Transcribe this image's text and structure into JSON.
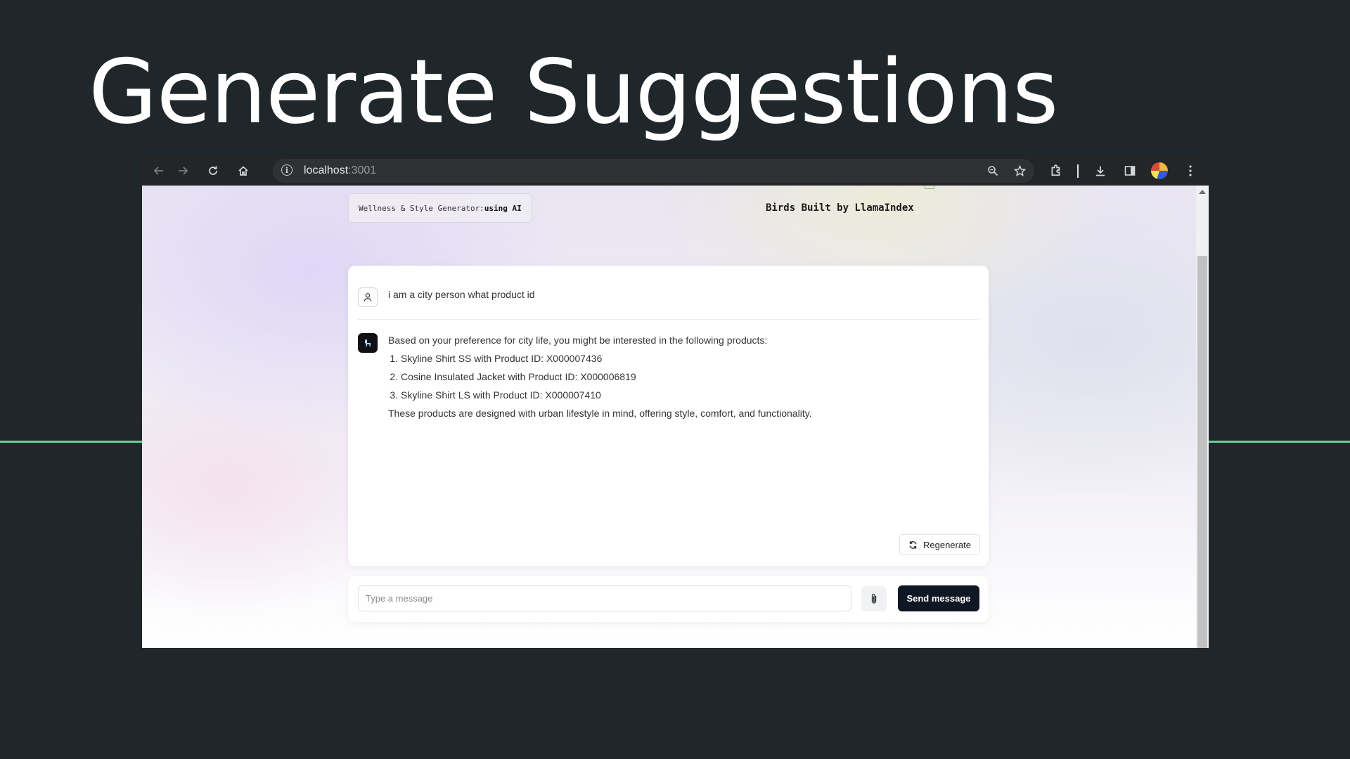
{
  "slide": {
    "title": "Generate Suggestions"
  },
  "browser": {
    "url_host": "localhost",
    "url_port": ":3001",
    "icons": [
      "back-icon",
      "forward-icon",
      "reload-icon",
      "home-icon",
      "site-info-icon",
      "zoom-icon",
      "bookmark-star-icon",
      "extensions-icon",
      "download-icon",
      "side-panel-icon",
      "profile-avatar",
      "menu-icon"
    ]
  },
  "app": {
    "badge_prefix": "Wellness & Style Generator:",
    "badge_strong": "using AI",
    "credit": "Birds Built by LlamaIndex"
  },
  "chat": {
    "user_message": "i am a city person what product id",
    "bot_intro": "Based on your preference for city life, you might be interested in the following products:",
    "bot_items": [
      "Skyline Shirt SS with Product ID: X000007436",
      "Cosine Insulated Jacket with Product ID: X000006819",
      "Skyline Shirt LS with Product ID: X000007410"
    ],
    "bot_outro": "These products are designed with urban lifestyle in mind, offering style, comfort, and functionality.",
    "regenerate_label": "Regenerate"
  },
  "composer": {
    "placeholder": "Type a message",
    "value": "",
    "send_label": "Send message"
  },
  "colors": {
    "slide_bg": "#20272a",
    "accent_line": "#5fd19a",
    "send_button": "#0f1624"
  }
}
